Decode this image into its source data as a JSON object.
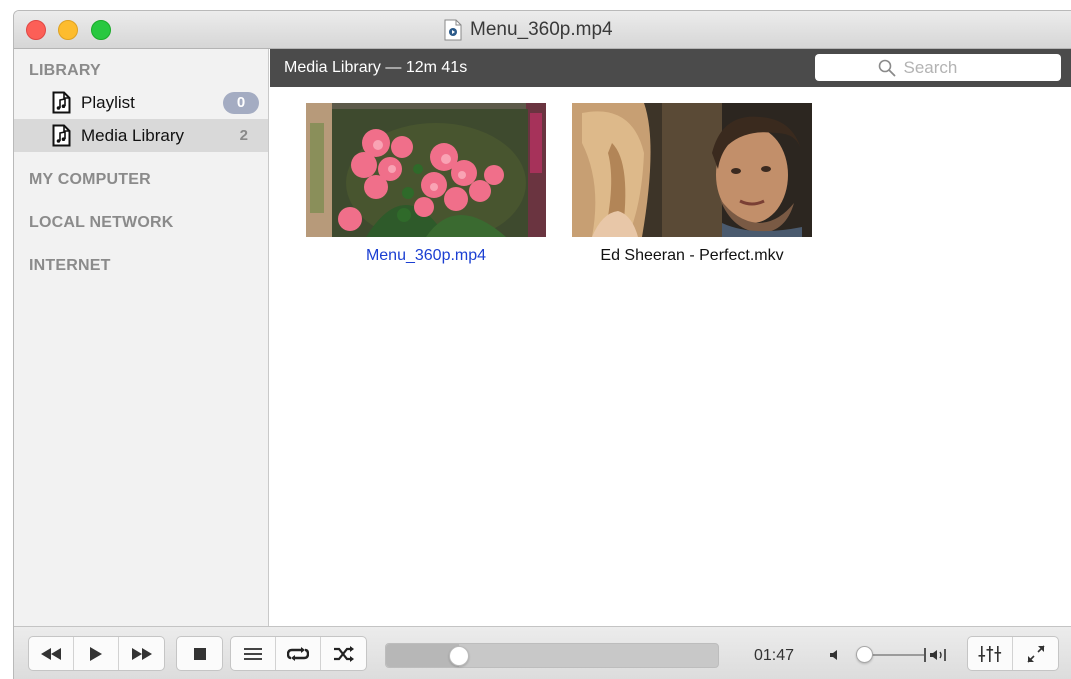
{
  "window": {
    "title": "Menu_360p.mp4"
  },
  "sidebar": {
    "sections": [
      {
        "header": "LIBRARY",
        "items": [
          {
            "label": "Playlist",
            "count": "0",
            "icon": "music-document-icon",
            "selected": false
          },
          {
            "label": "Media Library",
            "count": "2",
            "icon": "music-document-icon",
            "selected": true
          }
        ]
      },
      {
        "header": "MY COMPUTER"
      },
      {
        "header": "LOCAL NETWORK"
      },
      {
        "header": "INTERNET"
      }
    ]
  },
  "content": {
    "title": "Media Library — 12m 41s",
    "search": {
      "placeholder": "Search",
      "value": ""
    },
    "items": [
      {
        "name": "Menu_360p.mp4",
        "active": true,
        "thumb": "pink-flowers"
      },
      {
        "name": "Ed Sheeran - Perfect.mkv",
        "active": false,
        "thumb": "two-people"
      }
    ]
  },
  "controls": {
    "buttons": [
      "rewind-icon",
      "play-icon",
      "fast-forward-icon",
      "stop-icon",
      "playlist-icon",
      "repeat-icon",
      "shuffle-icon",
      "equalizer-icon",
      "fullscreen-icon"
    ],
    "progress_fraction": 0.22,
    "time": "01:47",
    "volume_fraction": 0.06
  },
  "colors": {
    "active_link": "#1b3fd2",
    "badge": "#a4acc2",
    "header_bar": "#4b4b4b",
    "close": "#fc5f57",
    "minimize": "#fdbc2e",
    "zoom": "#28c840"
  }
}
